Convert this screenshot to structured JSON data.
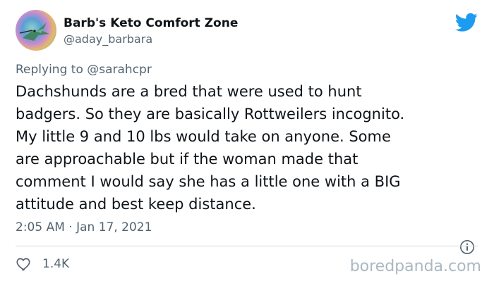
{
  "author": {
    "display_name": "Barb's Keto Comfort Zone",
    "handle": "@aday_barbara",
    "avatar_icon": "hummingbird-avatar"
  },
  "platform_icon": "twitter-bird-icon",
  "reply": {
    "prefix": "Replying to",
    "to_handle": "@sarahcpr"
  },
  "tweet": {
    "lines": [
      "Dachshunds are a bred that were used to hunt",
      "badgers. So they are basically Rottweilers incognito.",
      "My little 9 and 10 lbs would take on anyone. Some",
      "are approachable but if the woman made that",
      "comment I would say she has a little one with a BIG",
      "attitude and best keep distance."
    ],
    "timestamp": "2:05 AM · Jan 17, 2021"
  },
  "actions": {
    "like_count": "1.4K",
    "like_icon": "heart-icon",
    "info_icon": "info-icon"
  },
  "watermark": "boredpanda.com",
  "colors": {
    "twitter_blue": "#1d9bf0",
    "secondary_text": "#536471",
    "primary_text": "#0f1419",
    "divider": "#cfd9de",
    "watermark": "#aab8c2"
  }
}
